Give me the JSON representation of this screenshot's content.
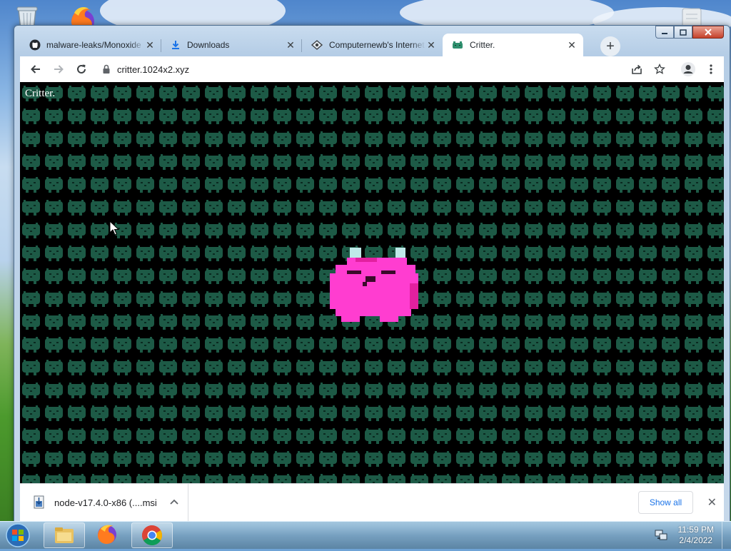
{
  "browser": {
    "tabs": [
      {
        "title": "malware-leaks/Monoxide",
        "icon": "github-icon",
        "active": false
      },
      {
        "title": "Downloads",
        "icon": "download-icon",
        "active": false
      },
      {
        "title": "Computernewb's Internet",
        "icon": "vm-icon",
        "active": false
      },
      {
        "title": "Critter.",
        "icon": "critter-icon",
        "active": true
      }
    ],
    "url": "critter.1024x2.xyz"
  },
  "page": {
    "brand": "Critter.",
    "background_color": "#000000",
    "pattern_color": "#1d5a46",
    "critter_color": "#ff3dd0",
    "critter_ear_color": "#bfe9e8"
  },
  "download_bar": {
    "file_name": "node-v17.4.0-x86 (....msi",
    "show_all_label": "Show all"
  },
  "taskbar": {
    "time": "11:59 PM",
    "date": "2/4/2022"
  }
}
